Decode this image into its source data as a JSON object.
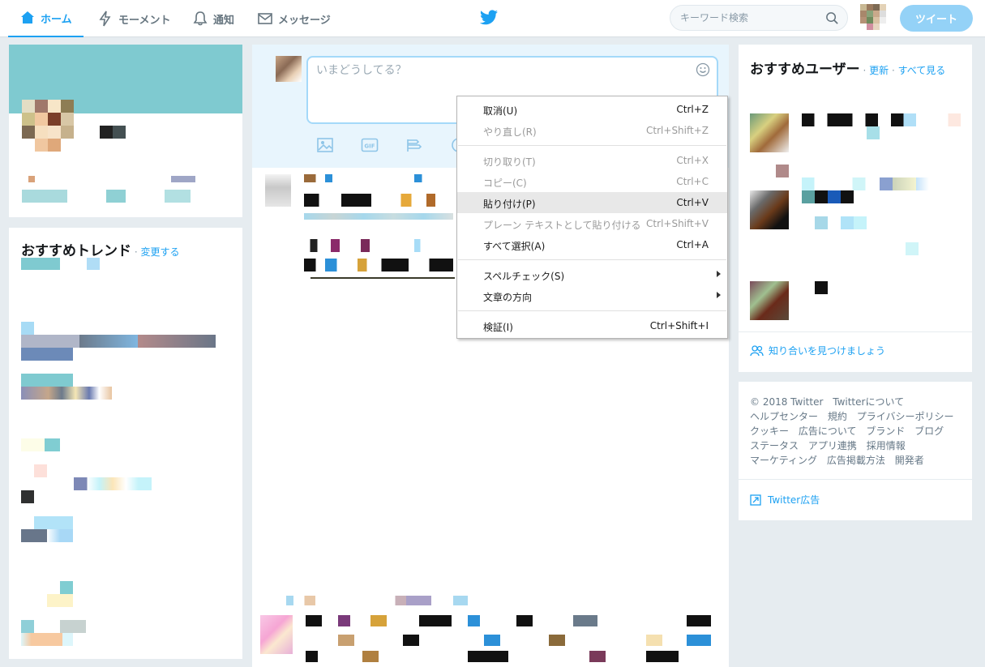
{
  "nav": {
    "home_label": "ホーム",
    "moments_label": "モーメント",
    "notifications_label": "通知",
    "messages_label": "メッセージ",
    "search_placeholder": "キーワード検索",
    "tweet_button": "ツイート"
  },
  "compose": {
    "placeholder": "いまどうしてる？"
  },
  "trends": {
    "title": "おすすめトレンド",
    "change_link": "変更する"
  },
  "who_to_follow": {
    "title": "おすすめユーザー",
    "refresh_link": "更新",
    "view_all_link": "すべて見る",
    "find_friends": "知り合いを見つけましょう"
  },
  "footer": {
    "links": [
      "© 2018 Twitter",
      "Twitterについて",
      "ヘルプセンター",
      "規約",
      "プライバシーポリシー",
      "クッキー",
      "広告について",
      "ブランド",
      "ブログ",
      "ステータス",
      "アプリ連携",
      "採用情報",
      "マーケティング",
      "広告掲載方法",
      "開発者"
    ],
    "ads_link": "Twitter広告"
  },
  "context_menu": {
    "items": [
      {
        "label": "取消(U)",
        "shortcut": "Ctrl+Z",
        "disabled": false
      },
      {
        "label": "やり直し(R)",
        "shortcut": "Ctrl+Shift+Z",
        "disabled": true
      },
      {
        "label": "切り取り(T)",
        "shortcut": "Ctrl+X",
        "disabled": true
      },
      {
        "label": "コピー(C)",
        "shortcut": "Ctrl+C",
        "disabled": true
      },
      {
        "label": "貼り付け(P)",
        "shortcut": "Ctrl+V",
        "disabled": false,
        "highlighted": true
      },
      {
        "label": "プレーン テキストとして貼り付ける",
        "shortcut": "Ctrl+Shift+V",
        "disabled": true
      },
      {
        "label": "すべて選択(A)",
        "shortcut": "Ctrl+A",
        "disabled": false
      },
      {
        "label": "スペルチェック(S)",
        "submenu": true
      },
      {
        "label": "文章の方向",
        "submenu": true
      },
      {
        "label": "検証(I)",
        "shortcut": "Ctrl+Shift+I",
        "disabled": false
      }
    ]
  },
  "colors": {
    "accent": "#1da1f2",
    "banner": "#7fcad0",
    "tweet_button": "#94d2f7"
  }
}
